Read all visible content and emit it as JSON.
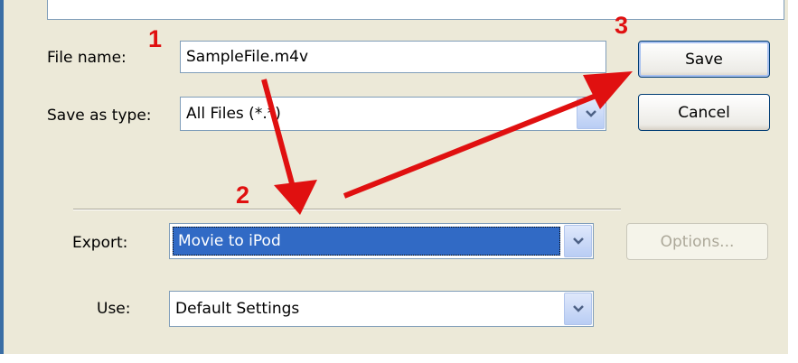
{
  "dialog": {
    "file_name_label": "File name:",
    "file_name_value": "SampleFile.m4v",
    "save_as_type_label": "Save as type:",
    "save_as_type_value": "All Files (*.*)",
    "save_button": "Save",
    "cancel_button": "Cancel",
    "export_label": "Export:",
    "export_value": "Movie to iPod",
    "options_button": "Options...",
    "use_label": "Use:",
    "use_value": "Default Settings"
  },
  "annotations": {
    "step1": "1",
    "step2": "2",
    "step3": "3",
    "color": "#e01010"
  },
  "icons": [
    "chevron-down-icon"
  ]
}
